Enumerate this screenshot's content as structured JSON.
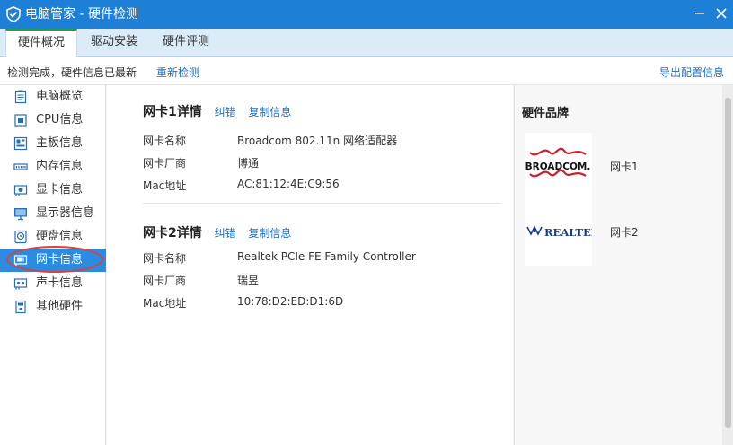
{
  "window": {
    "title": "电脑管家 - 硬件检测",
    "icons": {
      "logo": "shield-logo-icon",
      "minimize": "minimize-icon",
      "close": "close-icon"
    }
  },
  "tabs": [
    {
      "label": "硬件概况",
      "active": true
    },
    {
      "label": "驱动安装",
      "active": false
    },
    {
      "label": "硬件评测",
      "active": false
    }
  ],
  "status": {
    "message": "检测完成，硬件信息已最新",
    "recheck_label": "重新检测",
    "export_label": "导出配置信息"
  },
  "sidebar": {
    "items": [
      {
        "label": "电脑概览",
        "icon": "overview-icon"
      },
      {
        "label": "CPU信息",
        "icon": "cpu-icon"
      },
      {
        "label": "主板信息",
        "icon": "motherboard-icon"
      },
      {
        "label": "内存信息",
        "icon": "memory-icon"
      },
      {
        "label": "显卡信息",
        "icon": "graphics-card-icon"
      },
      {
        "label": "显示器信息",
        "icon": "monitor-icon"
      },
      {
        "label": "硬盘信息",
        "icon": "hard-disk-icon"
      },
      {
        "label": "网卡信息",
        "icon": "network-card-icon",
        "active": true
      },
      {
        "label": "声卡信息",
        "icon": "sound-card-icon"
      },
      {
        "label": "其他硬件",
        "icon": "other-hardware-icon"
      }
    ]
  },
  "nics": [
    {
      "title": "网卡1详情",
      "correct_label": "纠错",
      "copy_label": "复制信息",
      "fields": [
        {
          "key": "网卡名称",
          "value": "Broadcom 802.11n 网络适配器"
        },
        {
          "key": "网卡厂商",
          "value": "博通"
        },
        {
          "key": "Mac地址",
          "value": "AC:81:12:4E:C9:56"
        }
      ]
    },
    {
      "title": "网卡2详情",
      "correct_label": "纠错",
      "copy_label": "复制信息",
      "fields": [
        {
          "key": "网卡名称",
          "value": "Realtek PCIe FE Family Controller"
        },
        {
          "key": "网卡厂商",
          "value": "瑞昱"
        },
        {
          "key": "Mac地址",
          "value": "10:78:D2:ED:D1:6D"
        }
      ]
    }
  ],
  "brands": {
    "heading": "硬件品牌",
    "items": [
      {
        "logo_text": "BROADCOM.",
        "name": "网卡1",
        "icon": "broadcom-logo-icon"
      },
      {
        "logo_text": "REALTEK",
        "name": "网卡2",
        "icon": "realtek-logo-icon"
      }
    ]
  },
  "colors": {
    "title_bar": "#1d7fd6",
    "active_tab_accent": "#1aa34a",
    "link": "#1d6fc4",
    "sidebar_active": "#2b8be0",
    "highlight_ring": "#d9413d",
    "broadcom_red": "#cc1f2d",
    "realtek_blue": "#1a3b8c"
  }
}
